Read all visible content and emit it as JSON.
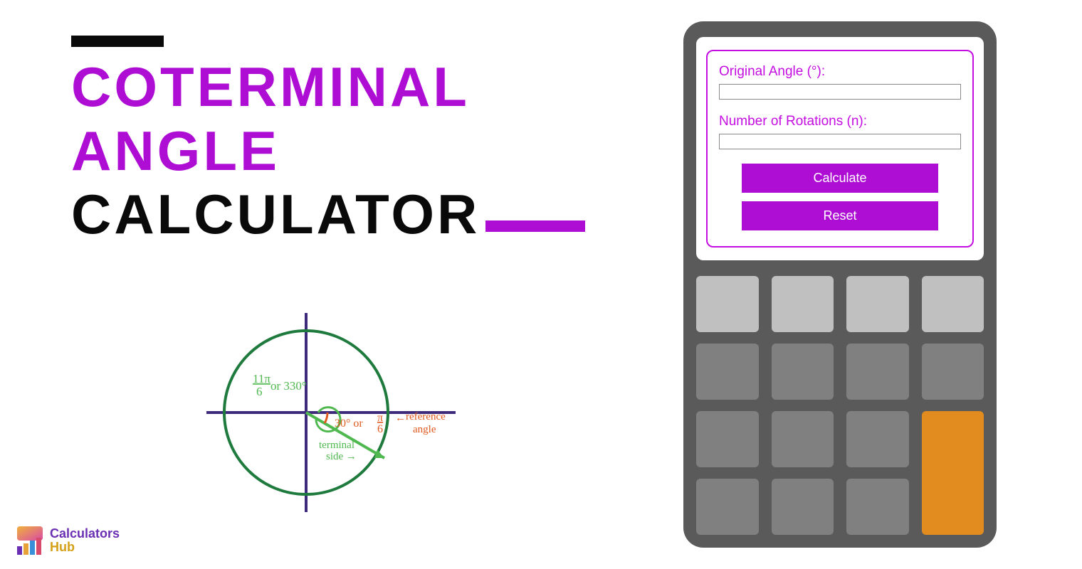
{
  "title": {
    "line1": "COTERMINAL",
    "line2": "ANGLE",
    "line3": "CALCULATOR"
  },
  "form": {
    "originalAngleLabel": "Original Angle (°):",
    "originalAngleValue": "",
    "rotationsLabel": "Number of Rotations (n):",
    "rotationsValue": "",
    "calculateLabel": "Calculate",
    "resetLabel": "Reset"
  },
  "diagram": {
    "angleLabel1": "11π/6 or 330°",
    "refAngleLabel": "30° or π/6",
    "refAngleNote": "reference angle",
    "terminalLabel": "terminal side"
  },
  "colors": {
    "accent": "#AE0DD4",
    "formBorder": "#C40DE0",
    "calcBody": "#5a5a5a",
    "keyLight": "#c0c0c0",
    "keyDark": "#808080",
    "keyOrange": "#e28c1f"
  },
  "logo": {
    "word1": "Calculators",
    "word2": "Hub"
  }
}
